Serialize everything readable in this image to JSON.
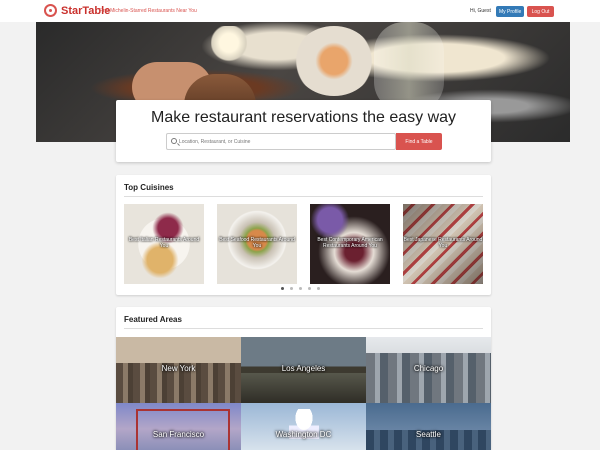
{
  "header": {
    "brand": "StarTable",
    "tagline": "Find Michelin-Starred Restaurants Near You",
    "greeting": "Hi, Guest",
    "profile_label": "My Profile",
    "logout_label": "Log Out"
  },
  "hero": {
    "title": "Make restaurant reservations the easy way",
    "search_placeholder": "Location, Restaurant, or Cuisine",
    "search_value": "",
    "find_label": "Find a Table"
  },
  "cuisines": {
    "title": "Top Cuisines",
    "items": [
      {
        "label": "Best Italian Restaurants Around You"
      },
      {
        "label": "Best Seafood Restaurants Around You"
      },
      {
        "label": "Best Contemporary American Restaurants Around You"
      },
      {
        "label": "Best Japanese Restaurants Around You"
      }
    ],
    "pages": 5,
    "active_page": 1
  },
  "areas": {
    "title": "Featured Areas",
    "items": [
      {
        "label": "New York"
      },
      {
        "label": "Los Angeles"
      },
      {
        "label": "Chicago"
      },
      {
        "label": "San Francisco"
      },
      {
        "label": "Washington DC"
      },
      {
        "label": "Seattle"
      }
    ]
  },
  "colors": {
    "accent": "#d9534f",
    "primary": "#337ab7"
  }
}
